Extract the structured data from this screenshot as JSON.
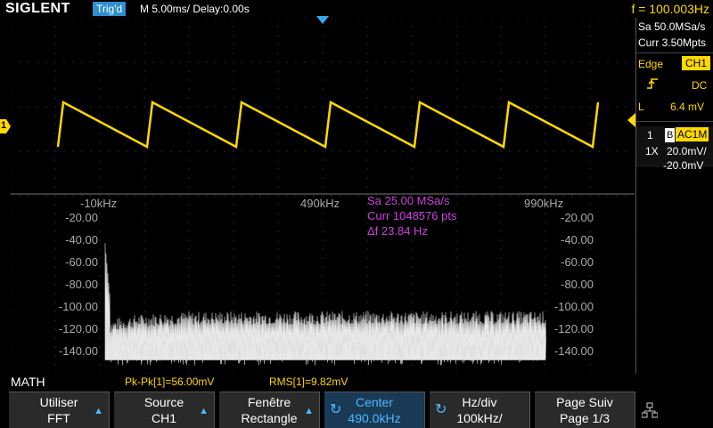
{
  "topbar": {
    "logo": "SIGLENT",
    "trig_status": "Trig'd",
    "timebase": "M 5.00ms/ Delay:0.00s",
    "frequency": "f = 100.003Hz"
  },
  "right_panel": {
    "sample_rate": "Sa 50.0MSa/s",
    "memory": "Curr 3.50Mpts",
    "trigger_type": "Edge",
    "trigger_source": "CH1",
    "slope_icon": "rising-edge-icon",
    "coupling": "DC",
    "level_label": "L",
    "level_value": "6.4 mV",
    "ch_number": "1",
    "bw_label": "B",
    "ch_coupling": "AC1M",
    "probe": "1X",
    "volts_div": "20.0mV/",
    "offset": "-20.0mV"
  },
  "channel_marker": "1",
  "fft": {
    "freq_labels": [
      "-10kHz",
      "490kHz",
      "990kHz"
    ],
    "db_labels_left": [
      "-20.00",
      "-40.00",
      "-60.00",
      "-80.00",
      "-100.00",
      "-120.00",
      "-140.00"
    ],
    "db_labels_right": [
      "-20.00",
      "-40.00",
      "-60.00",
      "-80.00",
      "-100.00",
      "-120.00",
      "-140.00"
    ],
    "info_sa": "Sa 25.00 MSa/s",
    "info_curr": "Curr 1048576 pts",
    "info_df": "Δf 23.84 Hz"
  },
  "status": {
    "math": "MATH",
    "pkpk": "Pk-Pk[1]=56.00mV",
    "rms": "RMS[1]=9.82mV"
  },
  "softkeys": [
    {
      "l1": "Utiliser",
      "l2": "FFT"
    },
    {
      "l1": "Source",
      "l2": "CH1"
    },
    {
      "l1": "Fenêtre",
      "l2": "Rectangle"
    },
    {
      "l1": "Center",
      "l2": "490.0kHz"
    },
    {
      "l1": "Hz/div",
      "l2": "100kHz/"
    },
    {
      "l1": "Page Suiv",
      "l2": "Page 1/3"
    }
  ],
  "colors": {
    "ch1": "#ffd800",
    "math_info": "#d040e0",
    "accent": "#35a8f0"
  }
}
